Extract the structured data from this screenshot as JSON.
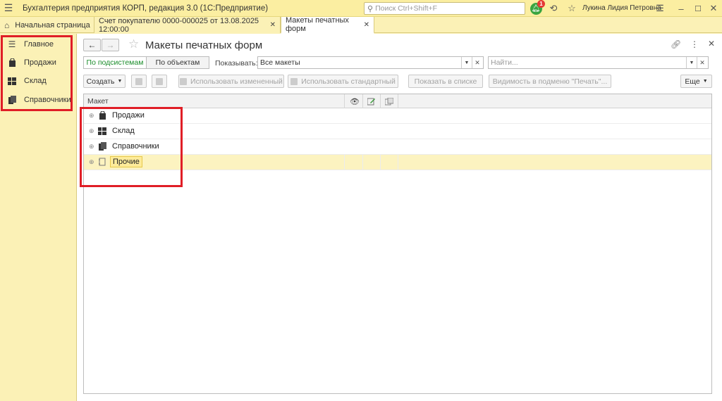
{
  "app": {
    "title": "Бухгалтерия предприятия КОРП, редакция 3.0  (1С:Предприятие)",
    "search_placeholder": "Поиск Ctrl+Shift+F",
    "notifications_count": "1",
    "user_name": "Лукина Лидия Петровна"
  },
  "tabs": {
    "home": "Начальная страница",
    "items": [
      {
        "label": "Счет покупателю 0000-000025 от 13.08.2025 12:00:00"
      },
      {
        "label": "Макеты печатных форм"
      }
    ]
  },
  "sidebar": {
    "items": [
      {
        "label": "Главное",
        "icon": "menu-lines-icon"
      },
      {
        "label": "Продажи",
        "icon": "shopping-bag-icon"
      },
      {
        "label": "Склад",
        "icon": "warehouse-grid-icon"
      },
      {
        "label": "Справочники",
        "icon": "books-icon"
      }
    ]
  },
  "form": {
    "title": "Макеты печатных форм",
    "view_modes": [
      "По подсистемам",
      "По объектам"
    ],
    "show_label": "Показывать:",
    "show_value": "Все макеты",
    "find_placeholder": "Найти...",
    "buttons": {
      "create": "Создать",
      "use_modified": "Использовать измененный",
      "use_standard": "Использовать стандартный",
      "show_in_list": "Показать в списке",
      "visibility": "Видимость в подменю \"Печать\"...",
      "more": "Еще"
    },
    "table": {
      "column_header": "Макет",
      "rows": [
        {
          "label": "Продажи",
          "icon": "shopping-bag-icon"
        },
        {
          "label": "Склад",
          "icon": "warehouse-grid-icon"
        },
        {
          "label": "Справочники",
          "icon": "books-icon"
        },
        {
          "label": "Прочие",
          "icon": "folder-outline-icon",
          "selected": true
        }
      ]
    }
  },
  "colors": {
    "accent_yellow": "#fbf1b6",
    "highlight_red": "#e01e26",
    "active_green": "#1a8c2a"
  }
}
